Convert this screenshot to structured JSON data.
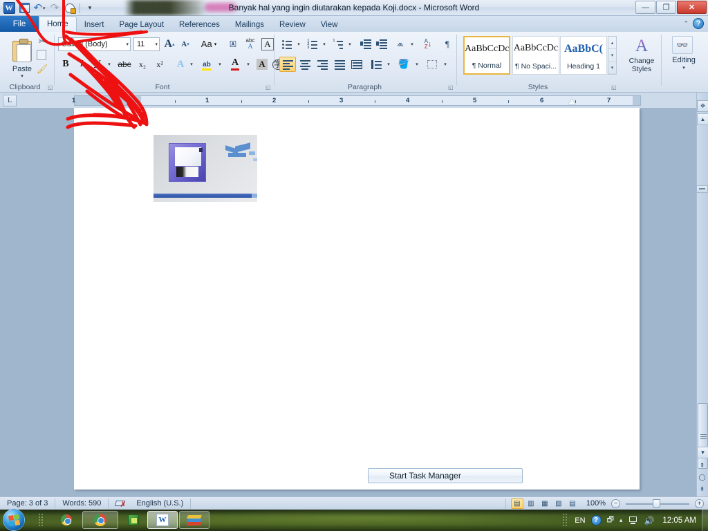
{
  "window": {
    "title": "Banyak hal yang ingin diutarakan kepada Koji.docx  -  Microsoft Word",
    "minimize": "—",
    "restore": "❐",
    "close": "✕"
  },
  "quick_access": {
    "app_logo": "W",
    "save": "save-icon",
    "undo": "↶",
    "undo_more": "▾",
    "redo": "↷",
    "print_preview": "print-preview-icon",
    "customize": "▾"
  },
  "tabs": [
    {
      "label": "File",
      "active": false,
      "file": true
    },
    {
      "label": "Home",
      "active": true
    },
    {
      "label": "Insert",
      "active": false
    },
    {
      "label": "Page Layout",
      "active": false
    },
    {
      "label": "References",
      "active": false
    },
    {
      "label": "Mailings",
      "active": false
    },
    {
      "label": "Review",
      "active": false
    },
    {
      "label": "View",
      "active": false
    }
  ],
  "ribbon": {
    "help_label": "?",
    "collapse_label": "⌃",
    "groups": [
      {
        "name": "Clipboard",
        "label": "Clipboard"
      },
      {
        "name": "Font",
        "label": "Font"
      },
      {
        "name": "Paragraph",
        "label": "Paragraph"
      },
      {
        "name": "Styles",
        "label": "Styles"
      }
    ],
    "clipboard": {
      "paste_label": "Paste",
      "paste_arrow": "▾",
      "cut_label": "✂",
      "copy_label": "copy-icon",
      "format_painter_label": "🖌"
    },
    "font": {
      "font_name": "Calibri (Body)",
      "font_size": "11",
      "grow_font": "A",
      "shrink_font": "A",
      "change_case": "Aa",
      "clear_formatting": "clear-formatting-icon",
      "phonetic": "abc",
      "char_border": "A",
      "bold": "B",
      "italic": "I",
      "underline": "U",
      "strikethrough": "abc",
      "subscript": "x₂",
      "superscript": "x²",
      "text_effects": "A",
      "highlight": "ab",
      "font_color": "A",
      "shading": "A",
      "enclose_char": "字",
      "dropdown": "▾"
    },
    "paragraph": {
      "bullets": "bullets-icon",
      "numbering": "numbering-icon",
      "multilevel": "multilevel-list-icon",
      "decrease_indent": "decrease-indent-icon",
      "increase_indent": "increase-indent-icon",
      "sort": "sort-icon",
      "sort_az": "A\nZ",
      "show_marks": "¶",
      "align_left": "align-left-icon",
      "align_center": "align-center-icon",
      "align_right": "align-right-icon",
      "justify": "justify-icon",
      "distributed": "distributed-icon",
      "line_spacing": "line-spacing-icon",
      "shading": "shading-icon",
      "borders": "borders-icon",
      "dropdown": "▾"
    },
    "styles": {
      "items": [
        {
          "sample": "AaBbCcDc",
          "name": "¶ Normal",
          "selected": true
        },
        {
          "sample": "AaBbCcDc",
          "name": "¶ No Spaci...",
          "selected": false
        },
        {
          "sample": "AaBbC(",
          "name": "Heading 1",
          "selected": false
        }
      ],
      "scroll_up": "▴",
      "scroll_down": "▾",
      "more": "▾",
      "change_styles_line1": "Change",
      "change_styles_line2": "Styles",
      "change_styles_arrow": "▾",
      "change_styles_icon": "A"
    },
    "editing": {
      "label": "Editing",
      "arrow": "▾",
      "icon": "binoculars-icon"
    }
  },
  "ruler": {
    "tab_selector": "L",
    "numbers": [
      "1",
      "1",
      "2",
      "3",
      "4",
      "5",
      "6",
      "7"
    ]
  },
  "document": {
    "embedded_image_name": "save-button-closeup-screenshot",
    "task_manager_button": "Start Task Manager"
  },
  "scrollbar": {
    "split": "split-box",
    "up": "▲",
    "down": "▼",
    "prev_page": "⇞",
    "select_browse_object": "◯",
    "next_page": "⇟"
  },
  "status_bar": {
    "page": "Page: 3 of 3",
    "words": "Words: 590",
    "proofing": "proofing-errors-icon",
    "language": "English (U.S.)",
    "views": [
      {
        "name": "print-layout",
        "glyph": "▤",
        "selected": true
      },
      {
        "name": "full-screen-reading",
        "glyph": "▥",
        "selected": false
      },
      {
        "name": "web-layout",
        "glyph": "▦",
        "selected": false
      },
      {
        "name": "outline",
        "glyph": "▧",
        "selected": false
      },
      {
        "name": "draft",
        "glyph": "▤",
        "selected": false
      }
    ],
    "zoom": "100%",
    "zoom_out": "−",
    "zoom_in": "+"
  },
  "taskbar": {
    "start": "start-orb",
    "items": [
      {
        "name": "chrome-pinned",
        "icon": "chrome-icon",
        "state": "pinned"
      },
      {
        "name": "chrome-window",
        "icon": "chrome-icon",
        "state": "running"
      },
      {
        "name": "green-app",
        "icon": "green-app-icon",
        "state": "pinned"
      },
      {
        "name": "word-window",
        "icon": "word-icon",
        "state": "active"
      },
      {
        "name": "books-app",
        "icon": "books-icon",
        "state": "running"
      }
    ],
    "tray": {
      "language": "EN",
      "help": "?",
      "overflow": "▴",
      "network": "network-icon",
      "volume": "🔊",
      "clock": "12:05 AM"
    }
  },
  "annotation": {
    "name": "red-scribble-arrow",
    "color": "#ee1111",
    "description": "hand-drawn red arrow pointing from the Save icon down into the document area"
  },
  "colors": {
    "accent": "#1f5fae",
    "ribbon_bg": "#e2eaf5",
    "selection": "#fbd271",
    "annotation_red": "#ee1111",
    "title_bar": "#dae4f0"
  }
}
